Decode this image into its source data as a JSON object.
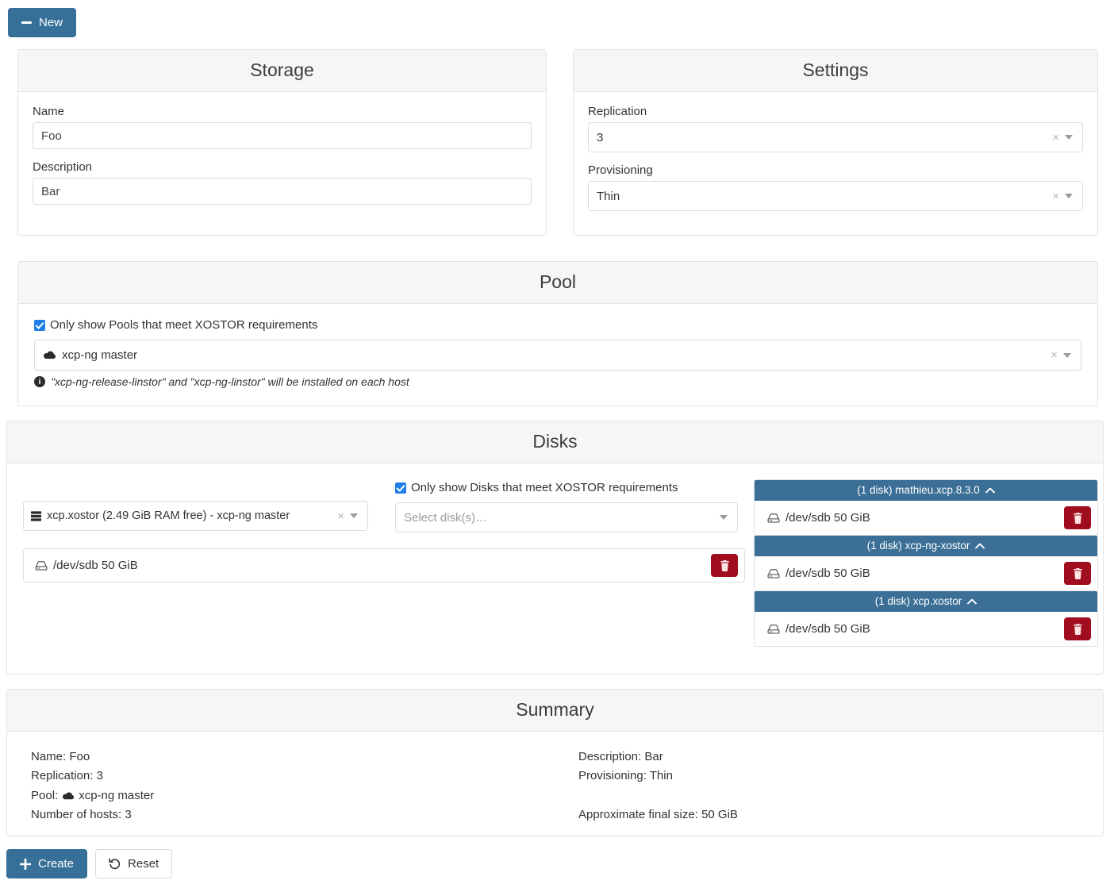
{
  "toolbar": {
    "new_label": "New",
    "new_icon": "minus-icon"
  },
  "storage": {
    "title": "Storage",
    "name_label": "Name",
    "name_value": "Foo",
    "name_placeholder": "Name",
    "description_label": "Description",
    "description_value": "Bar",
    "description_placeholder": "Description"
  },
  "settings": {
    "title": "Settings",
    "replication_label": "Replication",
    "replication_value": "3",
    "provisioning_label": "Provisioning",
    "provisioning_value": "Thin",
    "clear_glyph": "×"
  },
  "pool": {
    "title": "Pool",
    "filter_label": "Only show Pools that meet XOSTOR requirements",
    "filter_checked": true,
    "selected_pool": "xcp-ng master",
    "pool_icon": "cloud-icon",
    "clear_glyph": "×",
    "hint": "\"xcp-ng-release-linstor\" and \"xcp-ng-linstor\" will be installed on each host",
    "hint_icon": "info-icon"
  },
  "disks": {
    "title": "Disks",
    "host_select_value": "xcp.xostor (2.49 GiB RAM free) - xcp-ng master",
    "host_icon": "server-icon",
    "clear_glyph": "×",
    "filter_label": "Only show Disks that meet XOSTOR requirements",
    "filter_checked": true,
    "disk_select_placeholder": "Select disk(s)…",
    "selected_disks": [
      {
        "label": "/dev/sdb 50 GiB",
        "icon": "hdd-icon",
        "delete_icon": "trash-icon"
      }
    ],
    "host_groups": [
      {
        "header": "(1 disk) mathieu.xcp.8.3.0",
        "collapse_icon": "chevron-up-icon",
        "disks": [
          {
            "label": "/dev/sdb 50 GiB",
            "icon": "hdd-icon",
            "delete_icon": "trash-icon"
          }
        ]
      },
      {
        "header": "(1 disk) xcp-ng-xostor",
        "collapse_icon": "chevron-up-icon",
        "disks": [
          {
            "label": "/dev/sdb 50 GiB",
            "icon": "hdd-icon",
            "delete_icon": "trash-icon"
          }
        ]
      },
      {
        "header": "(1 disk) xcp.xostor",
        "collapse_icon": "chevron-up-icon",
        "disks": [
          {
            "label": "/dev/sdb 50 GiB",
            "icon": "hdd-icon",
            "delete_icon": "trash-icon"
          }
        ]
      }
    ]
  },
  "summary": {
    "title": "Summary",
    "left": {
      "name": "Name: Foo",
      "replication": "Replication: 3",
      "pool_prefix": "Pool:",
      "pool_value": "xcp-ng master",
      "pool_icon": "cloud-icon",
      "hosts": "Number of hosts: 3"
    },
    "right": {
      "description": "Description: Bar",
      "provisioning": "Provisioning: Thin",
      "final_size": "Approximate final size: 50 GiB"
    }
  },
  "actions": {
    "create_label": "Create",
    "create_icon": "plus-icon",
    "reset_label": "Reset",
    "reset_icon": "undo-icon"
  },
  "colors": {
    "accent_blue": "#366f98",
    "group_header_blue": "#3b6f96",
    "danger_red": "#a00d1e",
    "checkbox_blue": "#1f7fe8",
    "panel_head_bg": "#f6f6f6",
    "border": "#e3e3e3"
  }
}
